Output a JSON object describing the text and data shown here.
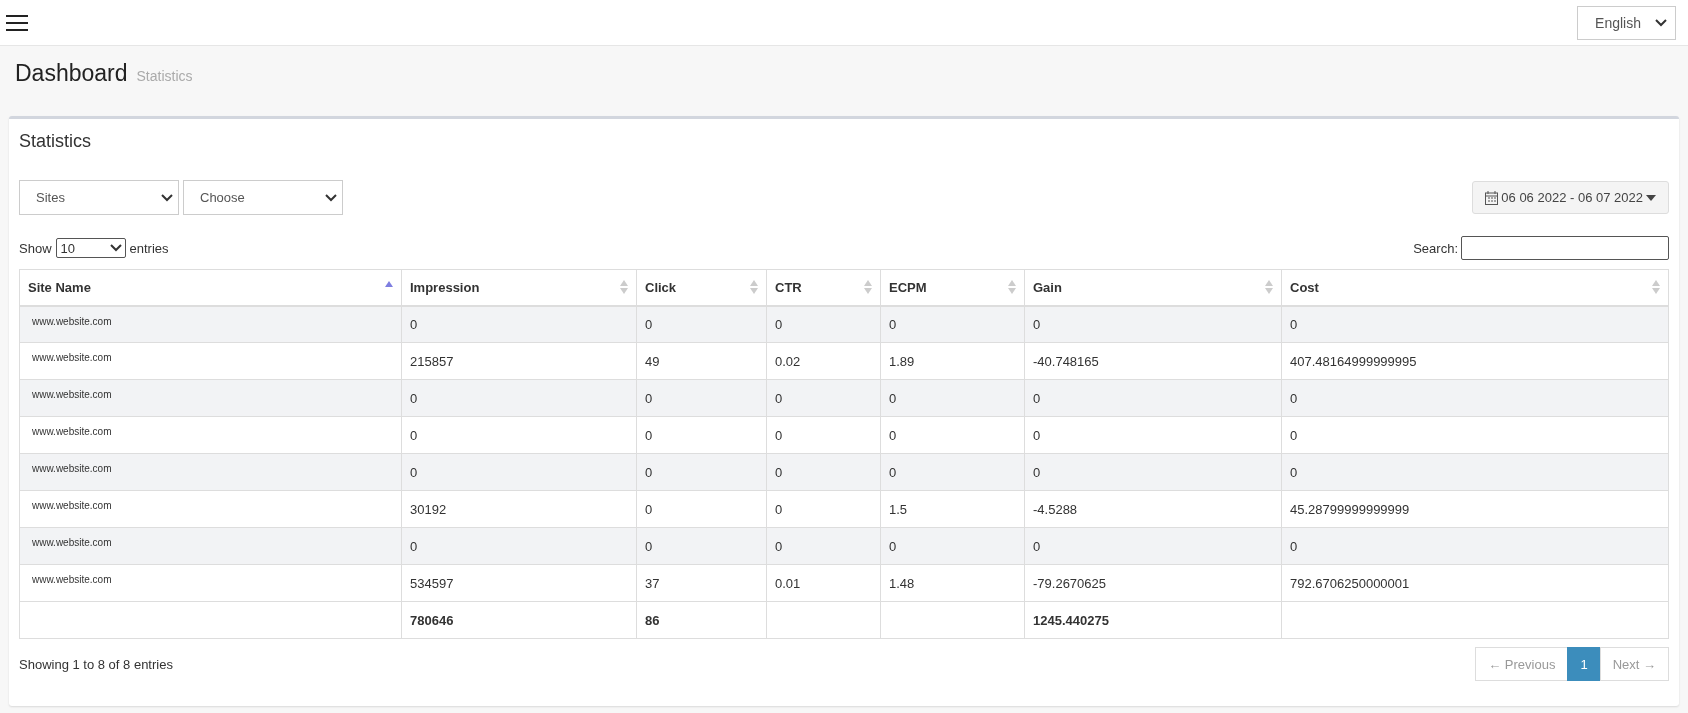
{
  "topbar": {
    "language": "English"
  },
  "header": {
    "title": "Dashboard",
    "subtitle": "Statistics"
  },
  "card": {
    "title": "Statistics",
    "filters": [
      {
        "value": "Sites"
      },
      {
        "value": "Choose"
      }
    ],
    "date_range": "06 06 2022 - 06 07 2022",
    "length": {
      "before": "Show",
      "value": "10",
      "after": "entries"
    },
    "search": {
      "label": "Search:"
    },
    "table": {
      "columns": [
        {
          "label": "Site Name",
          "sorted": true
        },
        {
          "label": "Impression",
          "sorted": false,
          "total": "780646"
        },
        {
          "label": "Click",
          "sorted": false,
          "total": "86"
        },
        {
          "label": "CTR",
          "sorted": false
        },
        {
          "label": "ECPM",
          "sorted": false
        },
        {
          "label": "Gain",
          "sorted": false,
          "total": "1245.440275"
        },
        {
          "label": "Cost",
          "sorted": false
        }
      ],
      "rows": [
        [
          "www.website.com",
          "0",
          "0",
          "0",
          "0",
          "0",
          "0"
        ],
        [
          "www.website.com",
          "215857",
          "49",
          "0.02",
          "1.89",
          "-40.748165",
          "407.48164999999995"
        ],
        [
          "www.website.com",
          "0",
          "0",
          "0",
          "0",
          "0",
          "0"
        ],
        [
          "www.website.com",
          "0",
          "0",
          "0",
          "0",
          "0",
          "0"
        ],
        [
          "www.website.com",
          "0",
          "0",
          "0",
          "0",
          "0",
          "0"
        ],
        [
          "www.website.com",
          "30192",
          "0",
          "0",
          "1.5",
          "-4.5288",
          "45.28799999999999"
        ],
        [
          "www.website.com",
          "0",
          "0",
          "0",
          "0",
          "0",
          "0"
        ],
        [
          "www.website.com",
          "534597",
          "37",
          "0.01",
          "1.48",
          "-79.2670625",
          "792.6706250000001"
        ]
      ]
    },
    "info": "Showing 1 to 8 of 8 entries",
    "pagination": [
      {
        "label": "← Previous",
        "disabled": true,
        "selected": false
      },
      {
        "label": "1",
        "disabled": false,
        "selected": true
      },
      {
        "label": "Next →",
        "disabled": true,
        "selected": false
      }
    ]
  }
}
